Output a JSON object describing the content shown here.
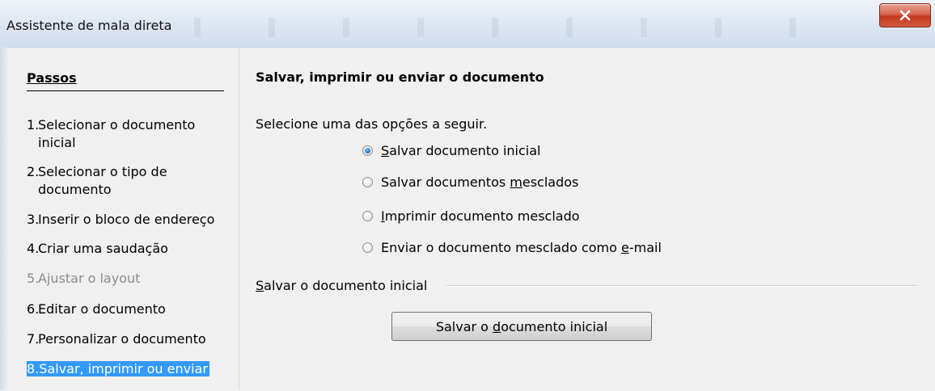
{
  "window": {
    "title": "Assistente de mala direta"
  },
  "steps": {
    "header": "Passos",
    "items": [
      {
        "number": "1.",
        "label": "Selecionar o documento inicial",
        "state": "normal"
      },
      {
        "number": "2.",
        "label": "Selecionar o tipo de documento",
        "state": "normal"
      },
      {
        "number": "3.",
        "label": "Inserir o bloco de endereço",
        "state": "normal"
      },
      {
        "number": "4.",
        "label": "Criar uma saudação",
        "state": "normal"
      },
      {
        "number": "5.",
        "label": "Ajustar o layout",
        "state": "disabled"
      },
      {
        "number": "6.",
        "label": "Editar o documento",
        "state": "normal"
      },
      {
        "number": "7.",
        "label": "Personalizar o documento",
        "state": "normal"
      },
      {
        "number": "8.",
        "label": "Salvar, imprimir ou enviar",
        "state": "selected"
      }
    ]
  },
  "main": {
    "title": "Salvar, imprimir ou enviar o documento",
    "instruction": "Selecione uma das opções a seguir.",
    "options": [
      {
        "before": "",
        "accel": "S",
        "after": "alvar documento inicial",
        "checked": true
      },
      {
        "before": "Salvar documentos ",
        "accel": "m",
        "after": "esclados",
        "checked": false
      },
      {
        "before": "",
        "accel": "I",
        "after": "mprimir documento mesclado",
        "checked": false
      },
      {
        "before": "Enviar o documento mesclado como ",
        "accel": "e",
        "after": "-mail",
        "checked": false
      }
    ],
    "section": {
      "accel": "S",
      "rest": "alvar o documento inicial"
    },
    "button": {
      "before": "Salvar o ",
      "accel": "d",
      "after": "ocumento inicial"
    }
  },
  "colors": {
    "selection": "#3399ff",
    "close_button": "#c2381f",
    "disabled_text": "#8d8d8d"
  },
  "icons": {
    "close": "close-x-icon"
  }
}
